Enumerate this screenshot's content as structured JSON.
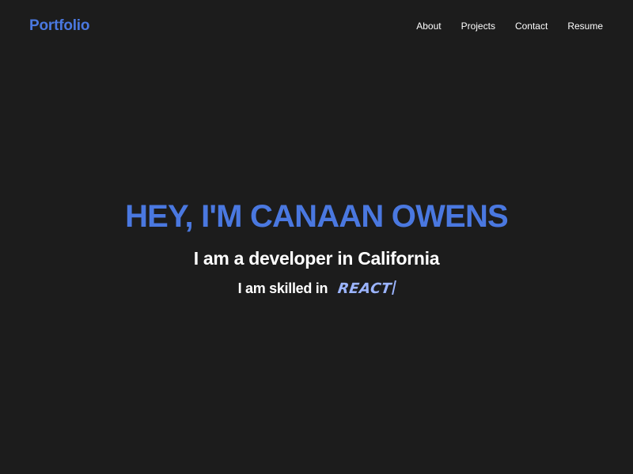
{
  "navbar": {
    "brand": "Portfolio",
    "links": [
      {
        "label": "About"
      },
      {
        "label": "Projects"
      },
      {
        "label": "Contact"
      },
      {
        "label": "Resume"
      }
    ]
  },
  "hero": {
    "title": "HEY, I'M CANAAN OWENS",
    "subtitle": "I am a developer in California",
    "skills_prefix": "I am skilled in",
    "skill_word": "REACT"
  },
  "colors": {
    "background": "#1c1c1c",
    "accent": "#4a78e0",
    "skill_highlight": "#9bb4ff",
    "text": "#ffffff"
  }
}
